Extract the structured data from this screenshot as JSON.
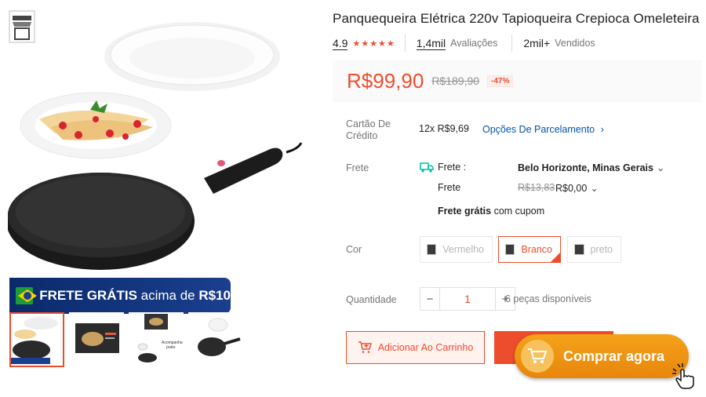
{
  "product": {
    "title": "Panquequeira Elétrica 220v Tapioqueira Crepioca Omeleteira",
    "rating": "4.9",
    "stars": "★★★★★",
    "reviews_count": "1,4mil",
    "reviews_label": "Avaliações",
    "sold_count": "2mil+",
    "sold_label": "Vendidos"
  },
  "price": {
    "current": "R$99,90",
    "original": "R$189,90",
    "discount": "-47%"
  },
  "credit": {
    "label": "Cartão De Crédito",
    "value": "12x R$9,69",
    "link": "Opções De Parcelamento",
    "link_chevron": "›"
  },
  "shipping": {
    "label": "Frete",
    "frete_label": "Frete :",
    "destination": "Belo Horizonte, Minas Gerais",
    "frete_label2": "Frete",
    "old_cost": "R$13,83",
    "new_cost": "R$0,00",
    "free_bold": "Frete grátis",
    "free_rest": " com cupom",
    "chevron": "⌄"
  },
  "color": {
    "label": "Cor",
    "options": [
      {
        "label": "Vermelho",
        "selected": false
      },
      {
        "label": "Branco",
        "selected": true
      },
      {
        "label": "preto",
        "selected": false
      }
    ]
  },
  "quantity": {
    "label": "Quantidade",
    "minus": "−",
    "value": "1",
    "plus": "+",
    "stock": "6 peças disponíveis"
  },
  "actions": {
    "add_to_cart": "Adicionar Ao Carrinho",
    "buy_now": "Comprar agora"
  },
  "gallery": {
    "banner_bold": "FRETE GRÁTIS",
    "banner_light": " acima de ",
    "banner_value": "R$10",
    "thumb_caption": "Acompanha prato"
  },
  "colors": {
    "accent": "#ee4d2d",
    "link": "#0055aa",
    "buy_orange": "#f5a21a"
  }
}
